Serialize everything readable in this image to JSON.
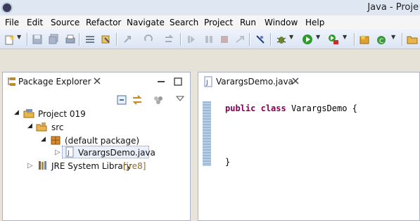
{
  "window": {
    "title": "Java - Proje"
  },
  "menu": [
    "File",
    "Edit",
    "Source",
    "Refactor",
    "Navigate",
    "Search",
    "Project",
    "Run",
    "Window",
    "Help"
  ],
  "explorer": {
    "tab_label": "Package Explorer",
    "tree": {
      "project": "Project 019",
      "src": "src",
      "package": "(default package)",
      "file": "VarargsDemo.java",
      "jre": "JRE System Library",
      "jre_tag": "[jre8]"
    }
  },
  "editor": {
    "tab_label": "VarargsDemo.java",
    "code": {
      "kw1": "public",
      "kw2": "class",
      "name": "VarargsDemo {",
      "close": "}"
    }
  },
  "colors": {
    "titlebar": "#dfe7f3",
    "keyword": "#7f0055",
    "jre_tag": "#8a6a2b",
    "selection": "#e9f0fb"
  },
  "icons": [
    "eclipse-icon",
    "new-icon",
    "save-icon",
    "save-all-icon",
    "print-icon",
    "toolbar-icons",
    "debug-icon",
    "run-icon",
    "coverage-icon",
    "new-java-project-icon",
    "new-class-icon",
    "open-folder-icon",
    "minimize-icon",
    "maximize-icon",
    "close-icon",
    "collapse-all-icon",
    "link-editor-icon",
    "view-menu-icon"
  ]
}
